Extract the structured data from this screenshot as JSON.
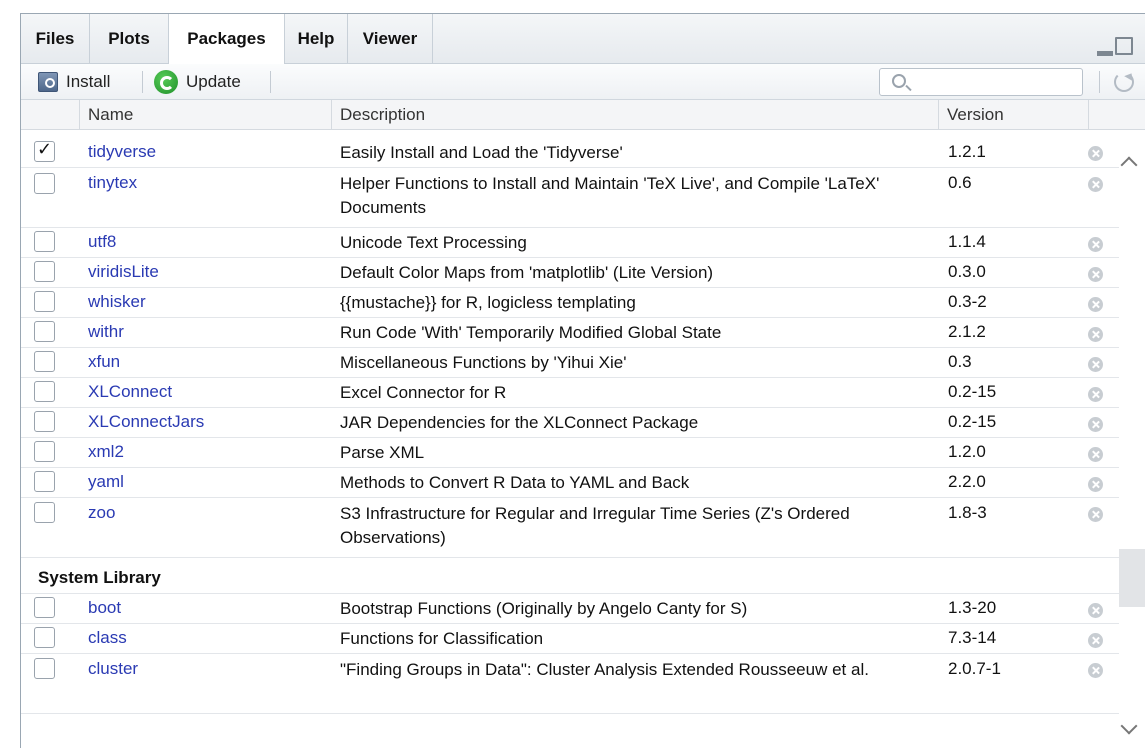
{
  "tabs": [
    "Files",
    "Plots",
    "Packages",
    "Help",
    "Viewer"
  ],
  "active_tab": "Packages",
  "toolbar": {
    "install_label": "Install",
    "update_label": "Update",
    "search_placeholder": ""
  },
  "columns": {
    "name": "Name",
    "description": "Description",
    "version": "Version"
  },
  "packages": [
    {
      "checked": true,
      "name": "tidyverse",
      "description": "Easily Install and Load the 'Tidyverse'",
      "version": "1.2.1"
    },
    {
      "checked": false,
      "name": "tinytex",
      "description": "Helper Functions to Install and Maintain 'TeX Live', and Compile 'LaTeX' Documents",
      "version": "0.6"
    },
    {
      "checked": false,
      "name": "utf8",
      "description": "Unicode Text Processing",
      "version": "1.1.4"
    },
    {
      "checked": false,
      "name": "viridisLite",
      "description": "Default Color Maps from 'matplotlib' (Lite Version)",
      "version": "0.3.0"
    },
    {
      "checked": false,
      "name": "whisker",
      "description": "{{mustache}} for R, logicless templating",
      "version": "0.3-2"
    },
    {
      "checked": false,
      "name": "withr",
      "description": "Run Code 'With' Temporarily Modified Global State",
      "version": "2.1.2"
    },
    {
      "checked": false,
      "name": "xfun",
      "description": "Miscellaneous Functions by 'Yihui Xie'",
      "version": "0.3"
    },
    {
      "checked": false,
      "name": "XLConnect",
      "description": "Excel Connector for R",
      "version": "0.2-15"
    },
    {
      "checked": false,
      "name": "XLConnectJars",
      "description": "JAR Dependencies for the XLConnect Package",
      "version": "0.2-15"
    },
    {
      "checked": false,
      "name": "xml2",
      "description": "Parse XML",
      "version": "1.2.0"
    },
    {
      "checked": false,
      "name": "yaml",
      "description": "Methods to Convert R Data to YAML and Back",
      "version": "2.2.0"
    },
    {
      "checked": false,
      "name": "zoo",
      "description": "S3 Infrastructure for Regular and Irregular Time Series (Z's Ordered Observations)",
      "version": "1.8-3"
    }
  ],
  "system_library": {
    "heading": "System Library",
    "packages": [
      {
        "checked": false,
        "name": "boot",
        "description": "Bootstrap Functions (Originally by Angelo Canty for S)",
        "version": "1.3-20"
      },
      {
        "checked": false,
        "name": "class",
        "description": "Functions for Classification",
        "version": "7.3-14"
      },
      {
        "checked": false,
        "name": "cluster",
        "description": "\"Finding Groups in Data\": Cluster Analysis Extended Rousseeuw et al.",
        "version": "2.0.7-1"
      }
    ]
  },
  "colors": {
    "package_link": "#2a3ab3",
    "update_icon": "#1f8f2a"
  }
}
